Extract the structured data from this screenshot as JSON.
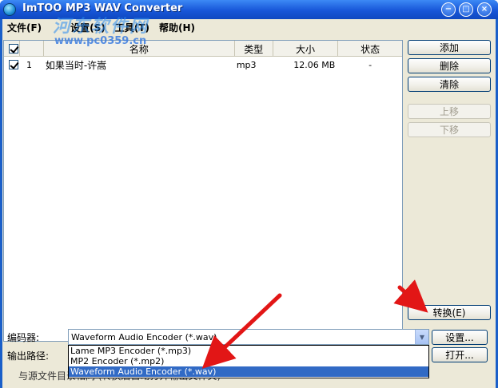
{
  "window": {
    "title": "ImTOO MP3 WAV Converter",
    "min_glyph": "−",
    "max_glyph": "□",
    "close_glyph": "×"
  },
  "watermark": {
    "text": "河东软件网",
    "url": "www.pc0359.cn"
  },
  "menu": {
    "items": [
      "文件(F)",
      "设置(S)",
      "工具(T)",
      "帮助(H)"
    ]
  },
  "list": {
    "headers": {
      "name": "名称",
      "type": "类型",
      "size": "大小",
      "status": "状态"
    },
    "rows": [
      {
        "checked": true,
        "index": "1",
        "name": "如果当时-许嵩",
        "type": "mp3",
        "size": "12.06 MB",
        "status": "-"
      }
    ]
  },
  "buttons": {
    "add": "添加",
    "delete": "删除",
    "clear": "清除",
    "move_up": "上移",
    "move_down": "下移",
    "convert": "转换(E)",
    "settings": "设置...",
    "open": "打开..."
  },
  "encoder": {
    "label": "编码器:",
    "selected": "Waveform Audio Encoder    (*.wav)",
    "options": [
      "Lame MP3 Encoder     (*.mp3)",
      "MP2 Encoder     (*.mp2)",
      "Waveform Audio Encoder     (*.wav)"
    ],
    "selected_index": 2
  },
  "output": {
    "label": "输出路径:"
  },
  "footer": {
    "text": "与源文件目录相同 (转换后自动打开输出文件夹)"
  },
  "colors": {
    "title_bar": "#1756d8",
    "selection": "#316ac5",
    "annotation_arrow": "#e21616"
  }
}
